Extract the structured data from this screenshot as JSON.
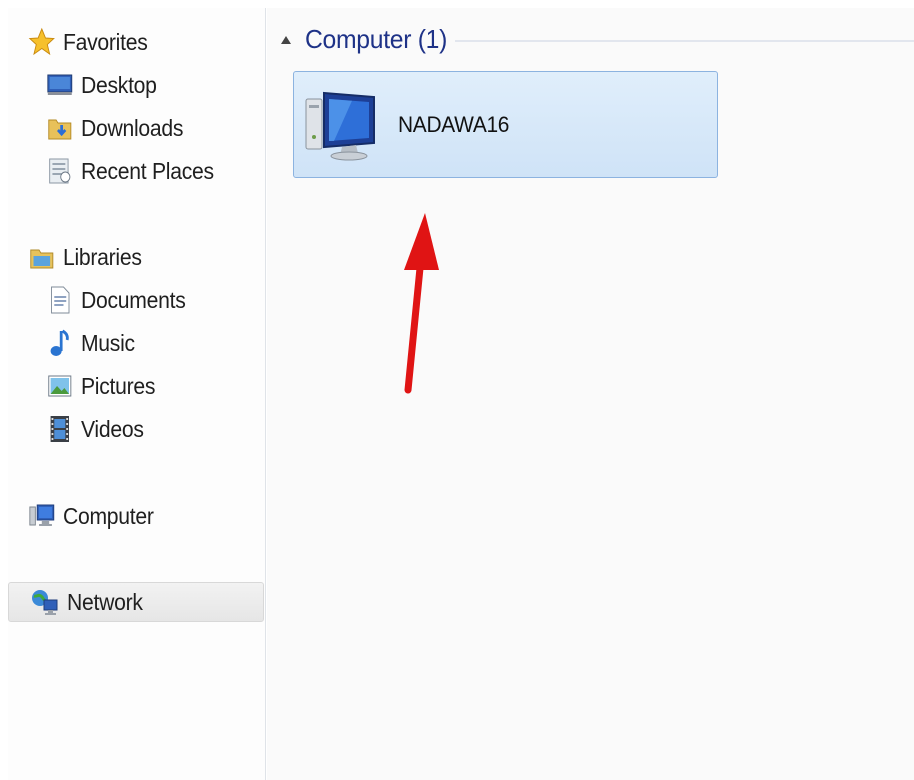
{
  "navigation": {
    "favorites": {
      "label": "Favorites",
      "items": [
        {
          "label": "Desktop",
          "icon": "desktop-icon"
        },
        {
          "label": "Downloads",
          "icon": "downloads-folder-icon"
        },
        {
          "label": "Recent Places",
          "icon": "recent-places-icon"
        }
      ]
    },
    "libraries": {
      "label": "Libraries",
      "items": [
        {
          "label": "Documents",
          "icon": "document-icon"
        },
        {
          "label": "Music",
          "icon": "music-note-icon"
        },
        {
          "label": "Pictures",
          "icon": "picture-icon"
        },
        {
          "label": "Videos",
          "icon": "film-icon"
        }
      ]
    },
    "computer": {
      "label": "Computer",
      "icon": "computer-icon"
    },
    "network": {
      "label": "Network",
      "icon": "network-icon",
      "selected": true
    }
  },
  "content": {
    "group_header": "Computer (1)",
    "items": [
      {
        "label": "NADAWA16",
        "icon": "computer-monitor-icon",
        "selected": true
      }
    ]
  },
  "annotation": {
    "icon": "red-arrow-icon",
    "color": "#e01414"
  },
  "colors": {
    "group_header_text": "#1e3287",
    "selection_fill": "#d6e8fa",
    "selection_border": "#8cb3e0"
  }
}
